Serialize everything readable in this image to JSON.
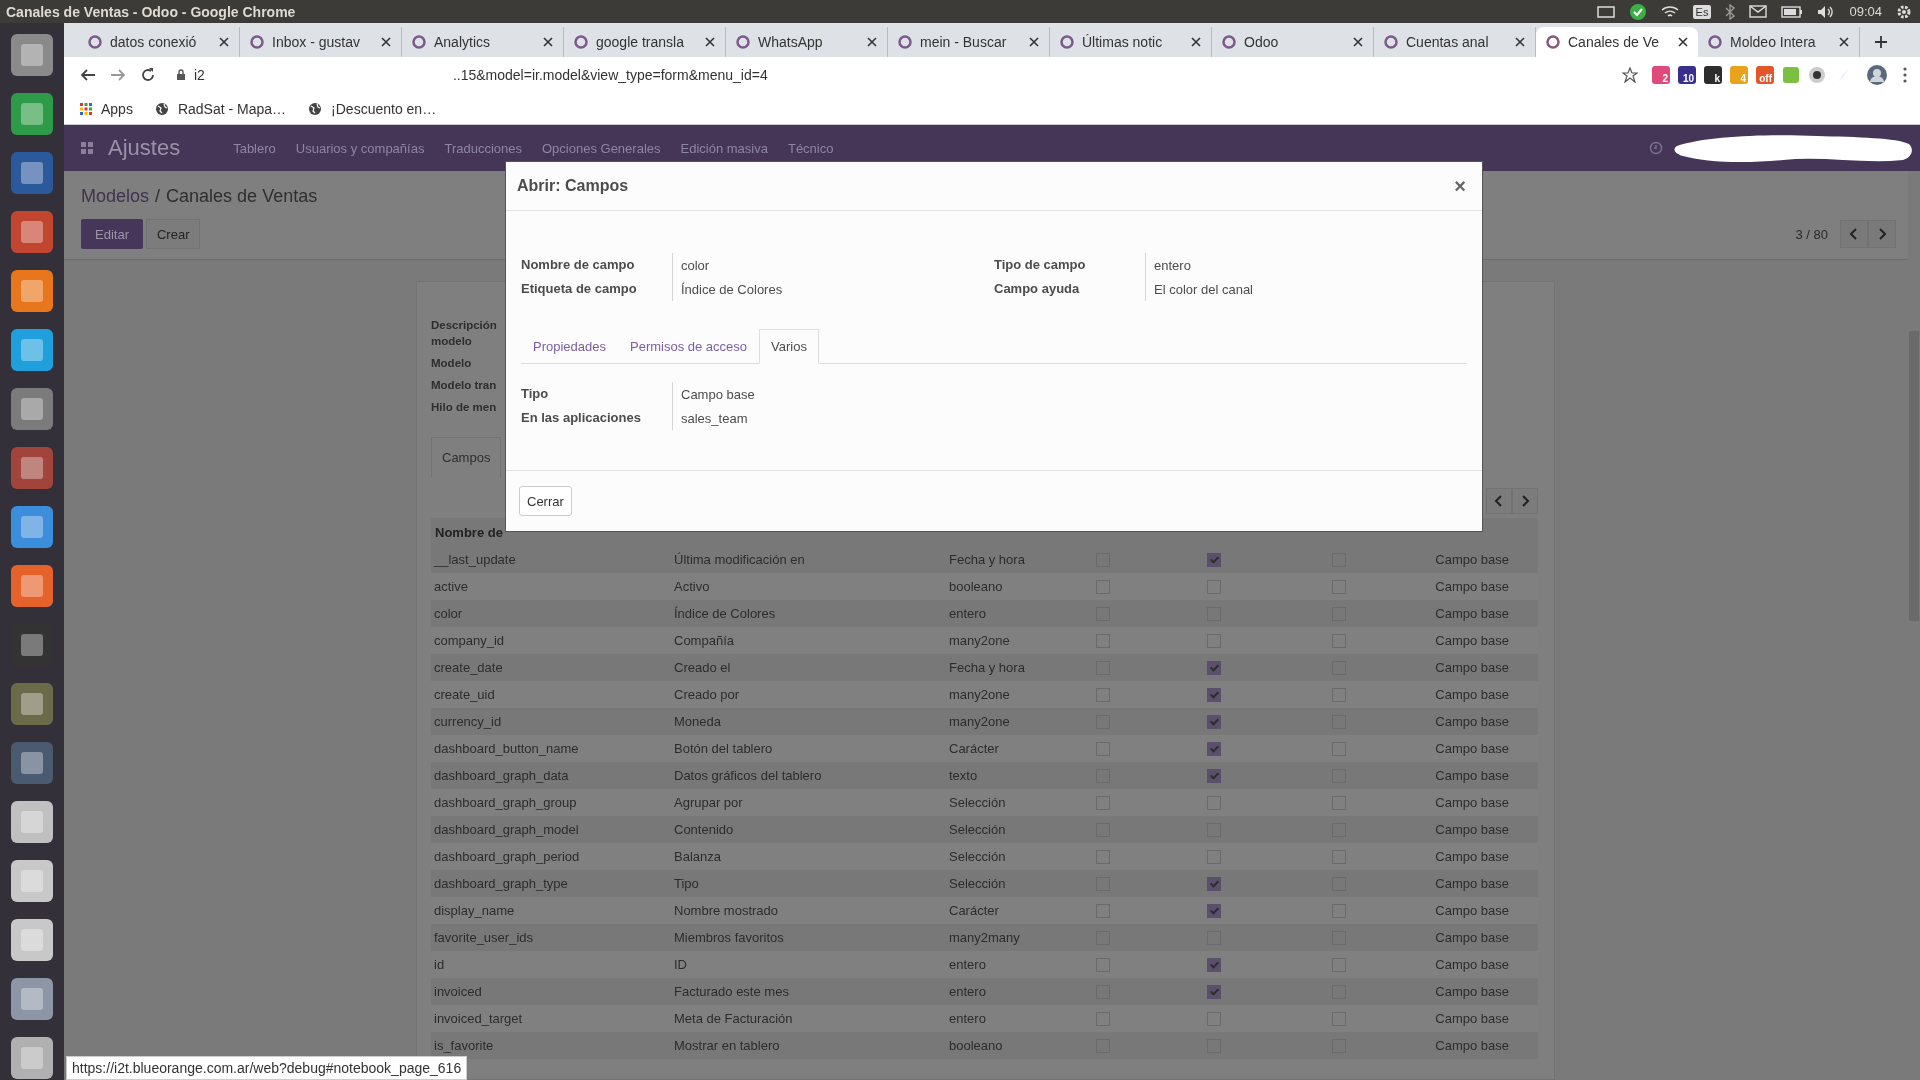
{
  "system_bar": {
    "title": "Canales de Ventas - Odoo - Google Chrome",
    "keyboard": "Es",
    "clock": "09:04"
  },
  "browser": {
    "tabs": [
      {
        "title": "datos conexió",
        "selected": false
      },
      {
        "title": "Inbox - gustav",
        "selected": false
      },
      {
        "title": "Analytics",
        "selected": false
      },
      {
        "title": "google transla",
        "selected": false
      },
      {
        "title": "WhatsApp",
        "selected": false
      },
      {
        "title": "mein - Buscar",
        "selected": false
      },
      {
        "title": "Últimas notic",
        "selected": false
      },
      {
        "title": "Odoo",
        "selected": false
      },
      {
        "title": "Cuentas anal",
        "selected": false
      },
      {
        "title": "Canales de Ve",
        "selected": true
      },
      {
        "title": "Moldeo Intera",
        "selected": false
      }
    ],
    "address": {
      "host": "i2",
      "rest": "..15&model=ir.model&view_type=form&menu_id=4"
    },
    "extension_badges": [
      "2",
      "10",
      "k",
      "4",
      "off"
    ],
    "bookmarks": [
      "Apps",
      "RadSat - Mapa…",
      "¡Descuento en…"
    ],
    "status_url": "https://i2t.blueorange.com.ar/web?debug#notebook_page_616"
  },
  "odoo": {
    "app": "Ajustes",
    "menu": [
      "Tablero",
      "Usuarios y compañías",
      "Traducciones",
      "Opciones Generales",
      "Edición masiva",
      "Técnico"
    ],
    "breadcrumb": [
      "Modelos",
      "Canales de Ventas"
    ],
    "breadcrumb_separator": "/",
    "edit_button": "Editar",
    "create_button": "Crear",
    "pager": "3 / 80",
    "form_labels": [
      "Descripción modelo",
      "Modelo",
      "Modelo tran",
      "Hilo de men"
    ],
    "notebook_tabs": [
      {
        "label": "Campos",
        "selected": true
      }
    ],
    "table_header": "Nombre de",
    "rows": [
      {
        "name": "__last_update",
        "label": "Última modificación en",
        "type": "Fecha y hora",
        "checks": [
          false,
          true,
          false
        ],
        "origin": "Campo base"
      },
      {
        "name": "active",
        "label": "Activo",
        "type": "booleano",
        "checks": [
          false,
          false,
          false
        ],
        "origin": "Campo base"
      },
      {
        "name": "color",
        "label": "Índice de Colores",
        "type": "entero",
        "checks": [
          false,
          false,
          false
        ],
        "origin": "Campo base"
      },
      {
        "name": "company_id",
        "label": "Compañía",
        "type": "many2one",
        "checks": [
          false,
          false,
          false
        ],
        "origin": "Campo base"
      },
      {
        "name": "create_date",
        "label": "Creado el",
        "type": "Fecha y hora",
        "checks": [
          false,
          true,
          false
        ],
        "origin": "Campo base"
      },
      {
        "name": "create_uid",
        "label": "Creado por",
        "type": "many2one",
        "checks": [
          false,
          true,
          false
        ],
        "origin": "Campo base"
      },
      {
        "name": "currency_id",
        "label": "Moneda",
        "type": "many2one",
        "checks": [
          false,
          true,
          false
        ],
        "origin": "Campo base"
      },
      {
        "name": "dashboard_button_name",
        "label": "Botón del tablero",
        "type": "Carácter",
        "checks": [
          false,
          true,
          false
        ],
        "origin": "Campo base"
      },
      {
        "name": "dashboard_graph_data",
        "label": "Datos gráficos del tablero",
        "type": "texto",
        "checks": [
          false,
          true,
          false
        ],
        "origin": "Campo base"
      },
      {
        "name": "dashboard_graph_group",
        "label": "Agrupar por",
        "type": "Selección",
        "checks": [
          false,
          false,
          false
        ],
        "origin": "Campo base"
      },
      {
        "name": "dashboard_graph_model",
        "label": "Contenido",
        "type": "Selección",
        "checks": [
          false,
          false,
          false
        ],
        "origin": "Campo base"
      },
      {
        "name": "dashboard_graph_period",
        "label": "Balanza",
        "type": "Selección",
        "checks": [
          false,
          false,
          false
        ],
        "origin": "Campo base"
      },
      {
        "name": "dashboard_graph_type",
        "label": "Tipo",
        "type": "Selección",
        "checks": [
          false,
          true,
          false
        ],
        "origin": "Campo base"
      },
      {
        "name": "display_name",
        "label": "Nombre mostrado",
        "type": "Carácter",
        "checks": [
          false,
          true,
          false
        ],
        "origin": "Campo base"
      },
      {
        "name": "favorite_user_ids",
        "label": "Miembros favoritos",
        "type": "many2many",
        "checks": [
          false,
          false,
          false
        ],
        "origin": "Campo base"
      },
      {
        "name": "id",
        "label": "ID",
        "type": "entero",
        "checks": [
          false,
          true,
          false
        ],
        "origin": "Campo base"
      },
      {
        "name": "invoiced",
        "label": "Facturado este mes",
        "type": "entero",
        "checks": [
          false,
          true,
          false
        ],
        "origin": "Campo base"
      },
      {
        "name": "invoiced_target",
        "label": "Meta de Facturación",
        "type": "entero",
        "checks": [
          false,
          false,
          false
        ],
        "origin": "Campo base"
      },
      {
        "name": "is_favorite",
        "label": "Mostrar en tablero",
        "type": "booleano",
        "checks": [
          false,
          false,
          false
        ],
        "origin": "Campo base"
      }
    ]
  },
  "dialog": {
    "title": "Abrir: Campos",
    "close_symbol": "×",
    "fields_left": [
      {
        "label": "Nombre de campo",
        "value": "color"
      },
      {
        "label": "Etiqueta de campo",
        "value": "Índice de Colores"
      }
    ],
    "fields_right": [
      {
        "label": "Tipo de campo",
        "value": "entero"
      },
      {
        "label": "Campo ayuda",
        "value": "El color del canal"
      }
    ],
    "tabs": [
      {
        "label": "Propiedades",
        "selected": false
      },
      {
        "label": "Permisos de acceso",
        "selected": false
      },
      {
        "label": "Varios",
        "selected": true
      }
    ],
    "tab_fields": [
      {
        "label": "Tipo",
        "value": "Campo base"
      },
      {
        "label": "En las aplicaciones",
        "value": "sales_team"
      }
    ],
    "close_button": "Cerrar"
  }
}
